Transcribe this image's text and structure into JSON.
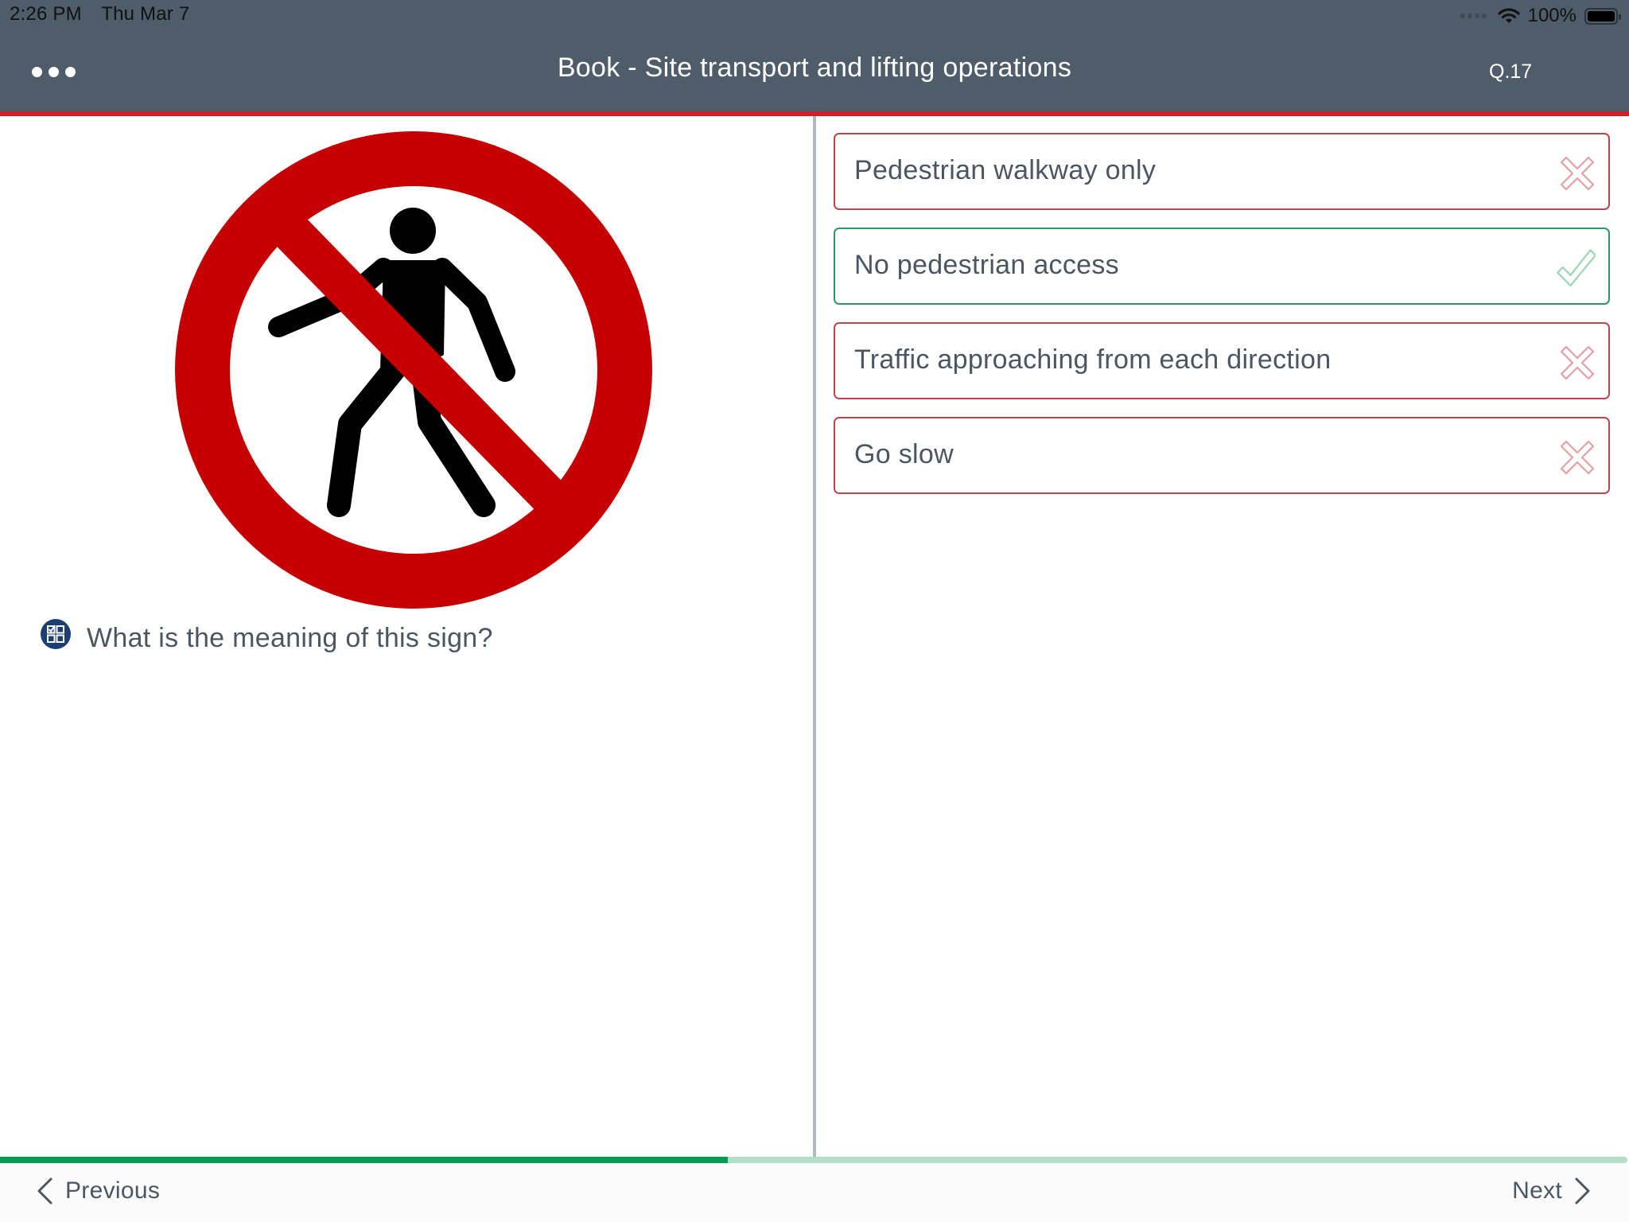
{
  "status_bar": {
    "time": "2:26 PM",
    "date": "Thu Mar 7",
    "battery_percent": "100%",
    "icons": [
      "cellular-signal-icon",
      "wifi-icon",
      "battery-icon"
    ]
  },
  "header": {
    "menu_icon": "more-horizontal-icon",
    "title": "Book - Site transport and lifting operations",
    "question_number": "Q.17",
    "accent_color": "#cc2229",
    "background_color": "#4e5d69"
  },
  "question": {
    "icon": "quiz-grid-icon",
    "text": "What is the meaning of this sign?",
    "image": "no-pedestrian-access-sign"
  },
  "options": [
    {
      "label": "Pedestrian walkway only",
      "state": "incorrect",
      "icon": "cross-icon"
    },
    {
      "label": "No pedestrian access",
      "state": "correct",
      "icon": "check-icon"
    },
    {
      "label": "Traffic approaching from each direction",
      "state": "incorrect",
      "icon": "cross-icon"
    },
    {
      "label": "Go slow",
      "state": "incorrect",
      "icon": "cross-icon"
    }
  ],
  "colors": {
    "incorrect_border": "#c0444c",
    "incorrect_icon": "#e6a0a5",
    "correct_border": "#2e9664",
    "correct_icon": "#9fd8bc",
    "progress_fill": "#009a50",
    "progress_track": "#b3dfc8"
  },
  "progress": {
    "fraction": 0.447
  },
  "footer": {
    "previous_label": "Previous",
    "next_label": "Next"
  }
}
